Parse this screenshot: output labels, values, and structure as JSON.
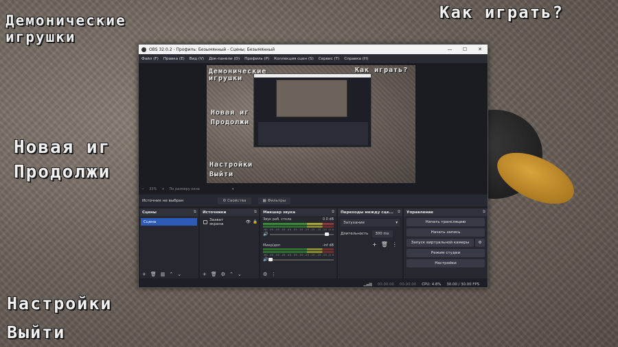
{
  "game_menu": {
    "title_line1": "Демонические",
    "title_line2": "игрушки",
    "how_to_play": "Как играть?",
    "new_game": "Новая иг",
    "continue": "Продолжи",
    "settings": "Настройки",
    "exit": "Выйти"
  },
  "obs": {
    "window_title": "OBS 32.0.2 - Профиль: Безымянный - Сцены: Безымянный",
    "window_buttons": [
      "—",
      "☐",
      "✕"
    ],
    "menu": [
      "Файл (F)",
      "Правка (E)",
      "Вид (V)",
      "Док-панели (D)",
      "Профиль (P)",
      "Коллекция сцен (S)",
      "Сервис (T)",
      "Справка (H)"
    ],
    "preview_text": {
      "title_line1": "Демонические",
      "title_line2": "игрушки",
      "how_to_play": "Как играть?",
      "new_game": "Новая иг",
      "continue": "Продолжи",
      "settings": "Настройки",
      "exit": "Выйти"
    },
    "zoom": {
      "minus": "−",
      "value": "33%",
      "plus": "+",
      "fit": "По размеру окна"
    },
    "source_bar": {
      "label": "Источник не выбран",
      "properties": "⚙ Свойства",
      "filters": "▦ Фильтры"
    },
    "scenes": {
      "header": "Сцены",
      "items": [
        "Сцена"
      ]
    },
    "sources": {
      "header": "Источники",
      "items": [
        "Захват экрана"
      ]
    },
    "mixer": {
      "header": "Микшер звука",
      "channels": [
        {
          "name": "Звук раб. стола",
          "db": "0.0 dB",
          "level": 0.92
        },
        {
          "name": "Микр/доп",
          "db": "-inf dB",
          "level": 0.04
        }
      ],
      "ticks": "-60 -55 -50 -45 -40 -35 -30 -25 -20 -15 -10 -5 0"
    },
    "transitions": {
      "header": "Переходы между сце...",
      "selected": "Затухание",
      "duration_label": "Длительность",
      "duration_value": "300 ms"
    },
    "controls": {
      "header": "Управление",
      "start_stream": "Начать трансляцию",
      "start_record": "Начать запись",
      "virtual_cam": "Запуск виртуальной камеры",
      "studio_mode": "Режим студии",
      "settings": "Настройки"
    },
    "status": {
      "stream_time": "00:00:00",
      "record_time": "00:00:00",
      "cpu": "CPU: 4.8%",
      "fps": "30.00 / 30.00 FPS"
    }
  }
}
